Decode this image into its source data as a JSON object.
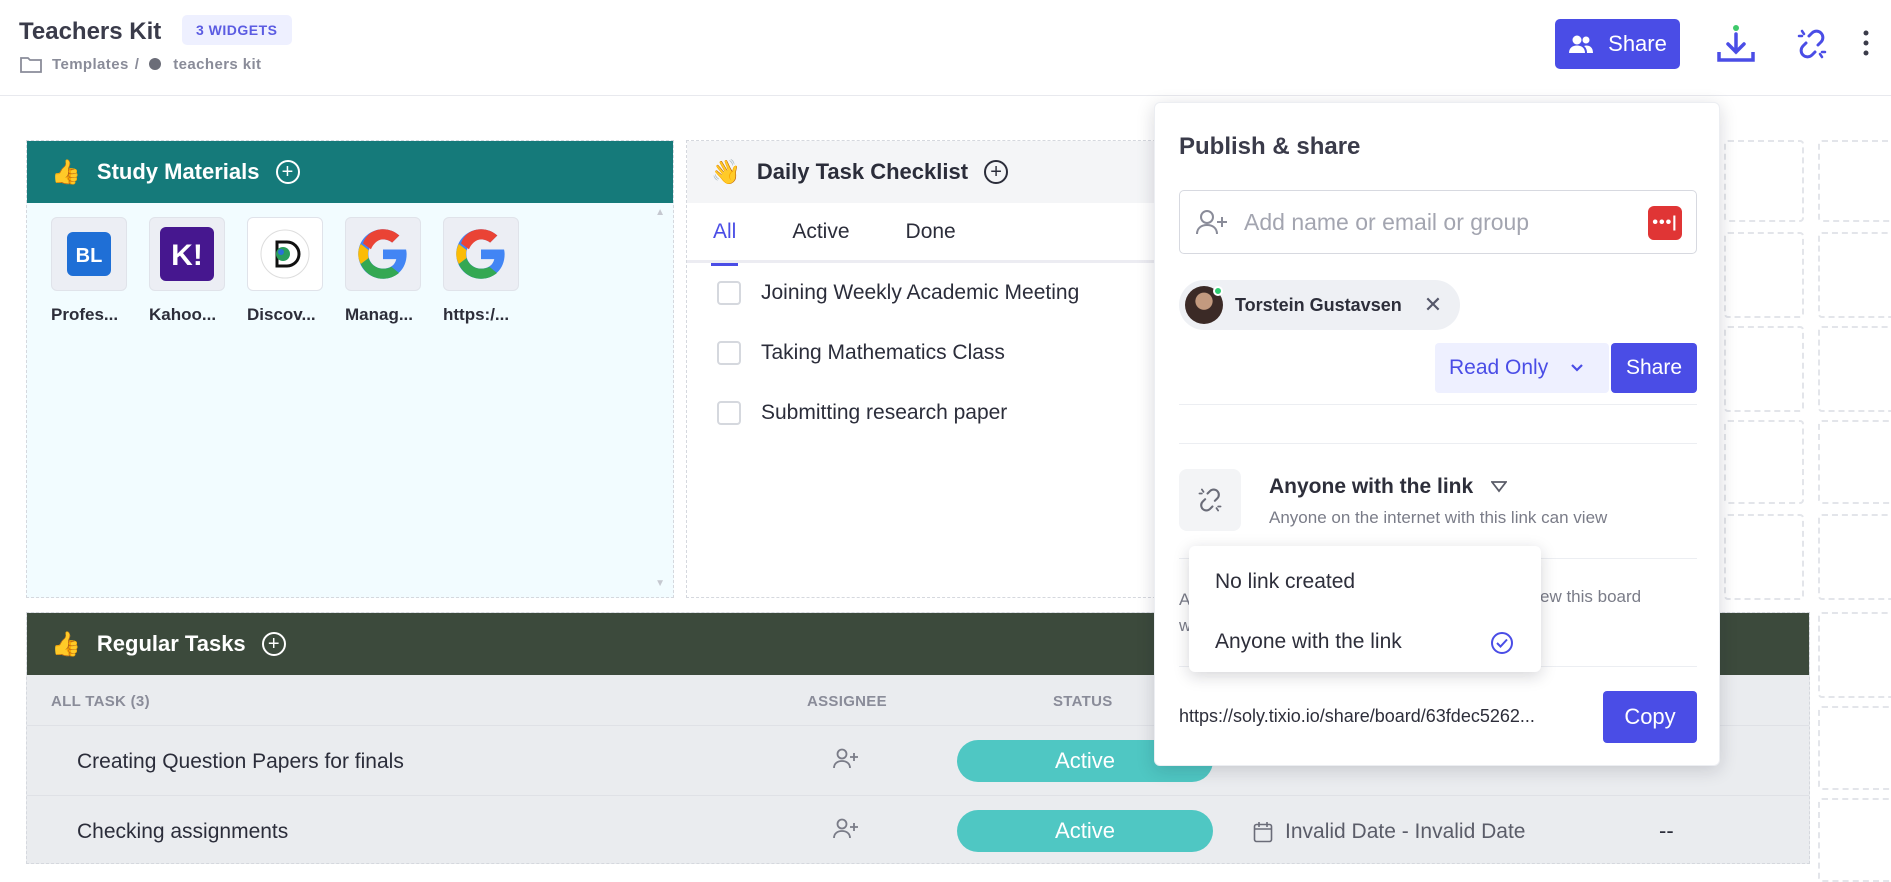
{
  "header": {
    "title": "Teachers Kit",
    "widgets_badge": "3 WIDGETS",
    "breadcrumb_root": "Templates",
    "breadcrumb_sep": "/",
    "breadcrumb_current": "teachers kit",
    "share_label": "Share"
  },
  "study_materials": {
    "title": "Study Materials",
    "apps": [
      {
        "label": "Profes...",
        "icon": "bl-logo"
      },
      {
        "label": "Kahoo...",
        "icon": "kahoot-logo"
      },
      {
        "label": "Discov...",
        "icon": "discovery-education-logo"
      },
      {
        "label": "Manag...",
        "icon": "google-logo"
      },
      {
        "label": "https:/...",
        "icon": "google-logo"
      }
    ]
  },
  "checklist": {
    "title": "Daily Task Checklist",
    "tabs": [
      "All",
      "Active",
      "Done"
    ],
    "tasks": [
      "Joining Weekly Academic Meeting",
      "Taking Mathematics Class",
      "Submitting research paper"
    ]
  },
  "regular_tasks": {
    "title": "Regular Tasks",
    "columns": {
      "all_task": "ALL TASK (3)",
      "assignee": "ASSIGNEE",
      "status": "STATUS"
    },
    "rows": [
      {
        "name": "Creating Question Papers for finals",
        "status": "Active"
      },
      {
        "name": "Checking assignments",
        "status": "Active",
        "dates": "Invalid Date - Invalid Date",
        "extra": "--"
      }
    ]
  },
  "share_popup": {
    "title": "Publish & share",
    "input_placeholder": "Add name or email or group",
    "lastpass_glyph": "•••|",
    "user_chip": "Torstein Gustavsen",
    "permission": "Read Only",
    "share_label": "Share",
    "link_title": "Anyone with the link",
    "link_subtitle": "Anyone on the internet with this link can view",
    "info_left_1": "A",
    "info_left_2": "w",
    "info_right": "ew this board",
    "url": "https://soly.tixio.io/share/board/63fdec5262...",
    "copy_label": "Copy"
  },
  "link_dropdown": {
    "options": [
      "No link created",
      "Anyone with the link"
    ],
    "selected": "Anyone with the link"
  },
  "colors": {
    "accent": "#4a4de6",
    "study_header": "#157a7a",
    "regular_header": "#3c4a3c",
    "status_active": "#4fc7c3"
  }
}
